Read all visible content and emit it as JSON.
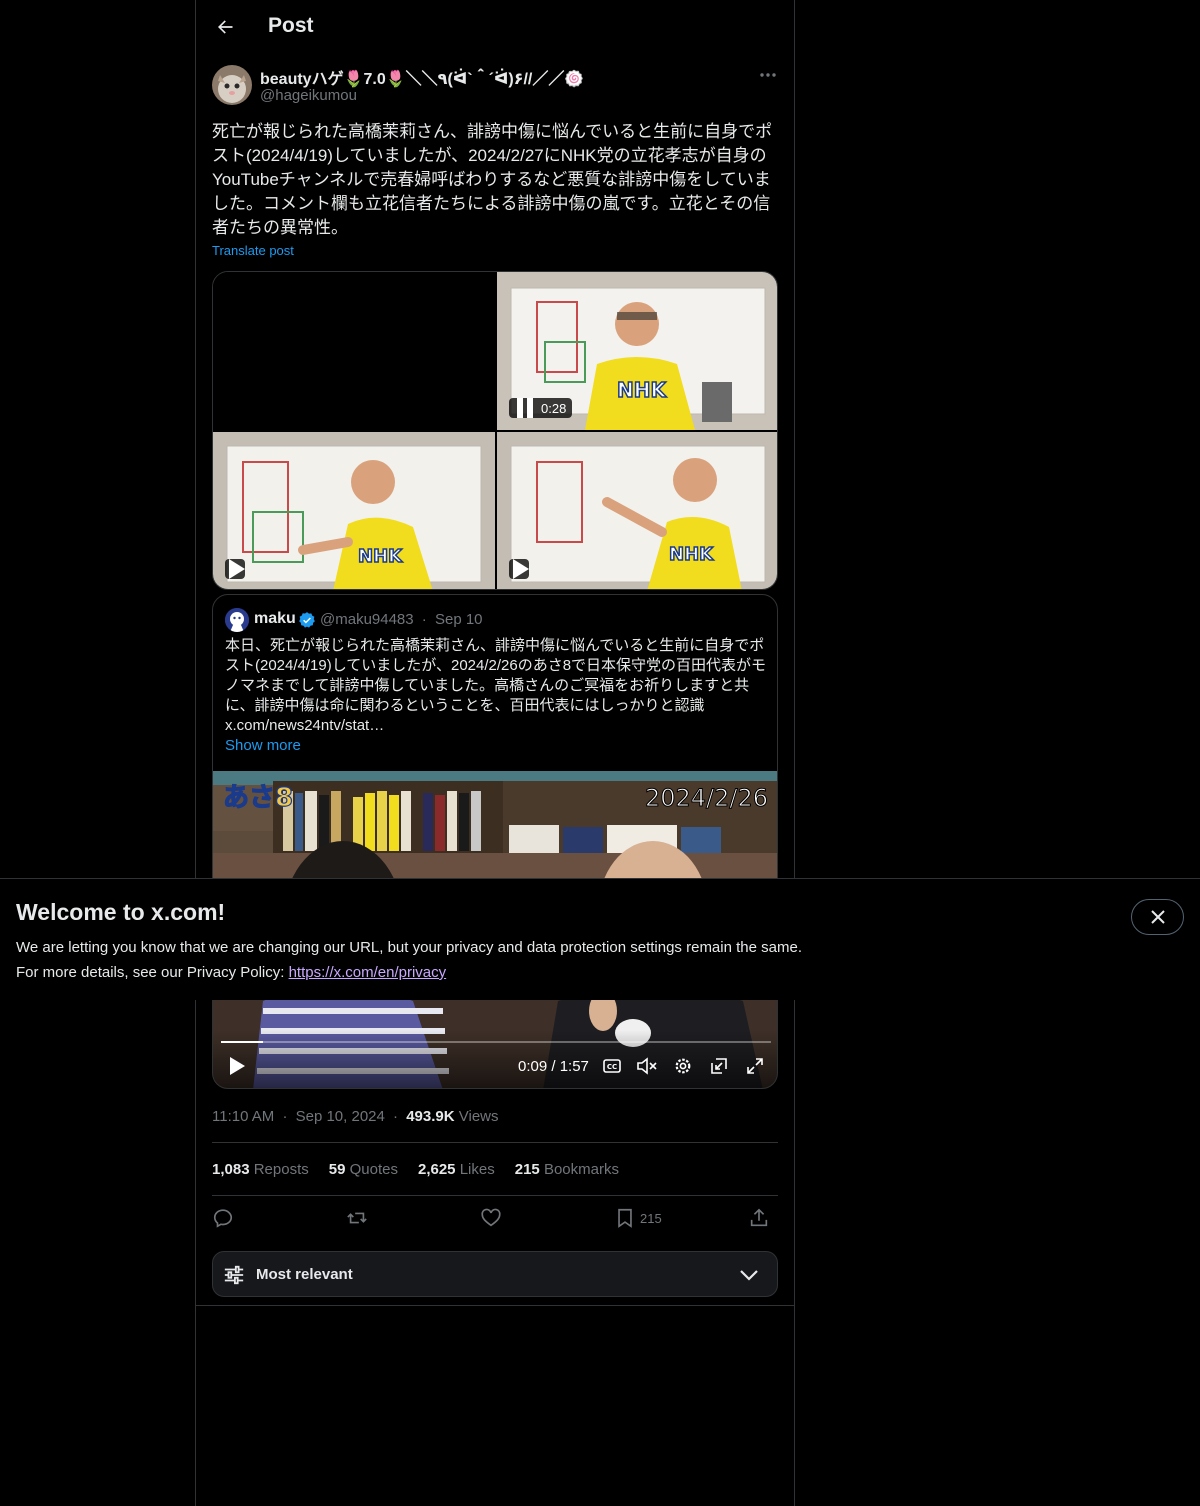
{
  "header": {
    "title": "Post"
  },
  "author": {
    "name": "beautyハゲ🌷7.0🌷＼＼٩(ᐛ`＾´ᐛ)۶//／／🍥",
    "handle": "@hageikumou"
  },
  "post": {
    "text": "死亡が報じられた高橋茉莉さん、誹謗中傷に悩んでいると生前に自身でポスト(2024/4/19)していましたが、2024/2/27にNHK党の立花孝志が自身のYouTubeチャンネルで売春婦呼ばわりするなど悪質な誹謗中傷をしていました。コメント欄も立花信者たちによる誹謗中傷の嵐です。立花とその信者たちの異常性。",
    "translate_label": "Translate post",
    "video_duration": "0:28"
  },
  "quote": {
    "name": "maku",
    "handle": "@maku94483",
    "separator": "·",
    "date": "Sep 10",
    "text": "本日、死亡が報じられた高橋茉莉さん、誹謗中傷に悩んでいると生前に自身でポスト(2024/4/19)していましたが、2024/2/26のあさ8で日本保守党の百田代表がモノマネまでして誹謗中傷していました。高橋さんのご冥福をお祈りしますと共に、誹謗中傷は命に関わるということを、百田代表にはしっかりと認識",
    "link_text": "x.com/news24ntv/stat…",
    "show_more": "Show more",
    "video": {
      "date_overlay": "2024/2/26",
      "show_logo": "あさ8",
      "time": "0:09 / 1:57",
      "progress": 0.077
    }
  },
  "meta": {
    "time": "11:10 AM",
    "sep": "·",
    "date": "Sep 10, 2024",
    "views_count": "493.9K",
    "views_label": "Views"
  },
  "stats": {
    "reposts_count": "1,083",
    "reposts_label": "Reposts",
    "quotes_count": "59",
    "quotes_label": "Quotes",
    "likes_count": "2,625",
    "likes_label": "Likes",
    "bookmarks_count": "215",
    "bookmarks_label": "Bookmarks"
  },
  "actions": {
    "bookmark_count": "215"
  },
  "sort": {
    "label": "Most relevant"
  },
  "banner": {
    "title": "Welcome to x.com!",
    "line1": "We are letting you know that we are changing our URL, but your privacy and data protection settings remain the same.",
    "line2_prefix": "For more details, see our Privacy Policy: ",
    "link": "https://x.com/en/privacy"
  },
  "colors": {
    "accent": "#1d9bf0",
    "muted": "#71767b",
    "border": "#2f3336",
    "shirt": "#f2dc1e"
  }
}
